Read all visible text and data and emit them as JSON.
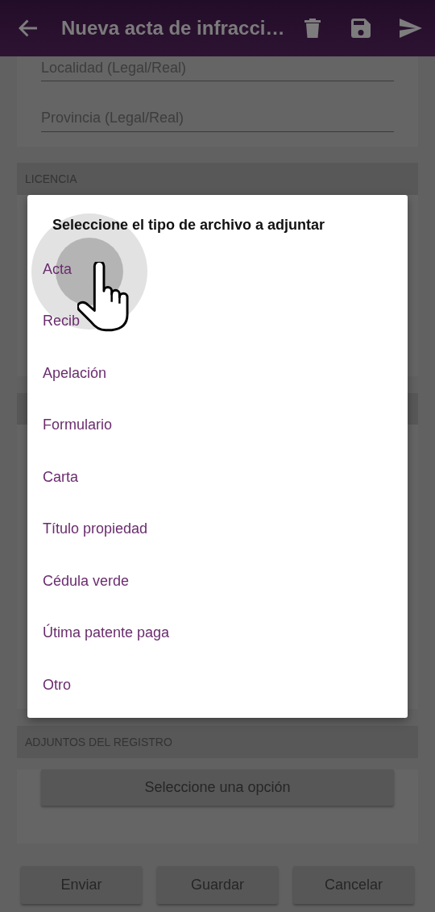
{
  "app_bar": {
    "title": "Nueva acta de infracci…"
  },
  "address_fields": [
    {
      "placeholder": "Localidad (Legal/Real)"
    },
    {
      "placeholder": "Provincia (Legal/Real)"
    }
  ],
  "license_section": {
    "header": "LICENCIA"
  },
  "dialog": {
    "title": "Seleccione el tipo de archivo a adjuntar",
    "options": [
      "Acta",
      "Recib",
      "Apelación",
      "Formulario",
      "Carta",
      "Título propiedad",
      "Cédula verde",
      "Útima patente paga",
      "Otro"
    ]
  },
  "attachments_section": {
    "header": "ADJUNTOS DEL REGISTRO",
    "select_label": "Seleccione una opción"
  },
  "buttons": [
    "Enviar",
    "Guardar",
    "Cancelar"
  ]
}
